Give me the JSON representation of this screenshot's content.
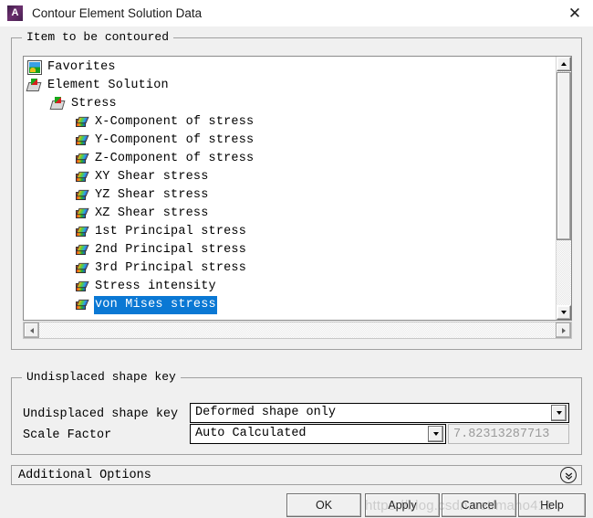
{
  "window": {
    "title": "Contour Element Solution Data",
    "app_icon": "ansys-a-icon",
    "close_icon": "close-icon"
  },
  "item_group": {
    "legend": "Item to be contoured",
    "tree": [
      {
        "label": "Favorites",
        "icon": "favorites-picture-icon",
        "indent": 1,
        "selected": false
      },
      {
        "label": "Element Solution",
        "icon": "open-folder-icon",
        "indent": 1,
        "selected": false
      },
      {
        "label": "Stress",
        "icon": "open-folder-icon",
        "indent": 2,
        "selected": false
      },
      {
        "label": "X-Component of stress",
        "icon": "result-cube-icon",
        "indent": 3,
        "selected": false
      },
      {
        "label": "Y-Component of stress",
        "icon": "result-cube-icon",
        "indent": 3,
        "selected": false
      },
      {
        "label": "Z-Component of stress",
        "icon": "result-cube-icon",
        "indent": 3,
        "selected": false
      },
      {
        "label": "XY Shear stress",
        "icon": "result-cube-icon",
        "indent": 3,
        "selected": false
      },
      {
        "label": "YZ Shear stress",
        "icon": "result-cube-icon",
        "indent": 3,
        "selected": false
      },
      {
        "label": "XZ Shear stress",
        "icon": "result-cube-icon",
        "indent": 3,
        "selected": false
      },
      {
        "label": "1st Principal stress",
        "icon": "result-cube-icon",
        "indent": 3,
        "selected": false
      },
      {
        "label": "2nd Principal stress",
        "icon": "result-cube-icon",
        "indent": 3,
        "selected": false
      },
      {
        "label": "3rd Principal stress",
        "icon": "result-cube-icon",
        "indent": 3,
        "selected": false
      },
      {
        "label": "Stress intensity",
        "icon": "result-cube-icon",
        "indent": 3,
        "selected": false
      },
      {
        "label": "von Mises stress",
        "icon": "result-cube-icon",
        "indent": 3,
        "selected": true
      }
    ],
    "selection_color": "#0a78d4",
    "scrollbar_v": {
      "up_icon": "scroll-up-arrow-icon",
      "down_icon": "scroll-down-arrow-icon"
    },
    "scrollbar_h": {
      "left_icon": "scroll-left-arrow-icon",
      "right_icon": "scroll-right-arrow-icon"
    }
  },
  "undisplaced_group": {
    "legend": "Undisplaced shape key",
    "shape_key_label": "Undisplaced shape key",
    "shape_key_value": "Deformed shape only",
    "scale_factor_label": "Scale Factor",
    "scale_factor_value": "Auto Calculated",
    "scale_factor_number": "7.82313287713",
    "dropdown_icon": "chevron-down-icon"
  },
  "additional_options": {
    "label": "Additional Options",
    "expand_icon": "double-chevron-down-circle-icon"
  },
  "buttons": {
    "ok": "OK",
    "apply": "Apply",
    "cancel": "Cancel",
    "help": "Help"
  },
  "watermark": {
    "text": "https://blog.csdn.net/maho411"
  }
}
